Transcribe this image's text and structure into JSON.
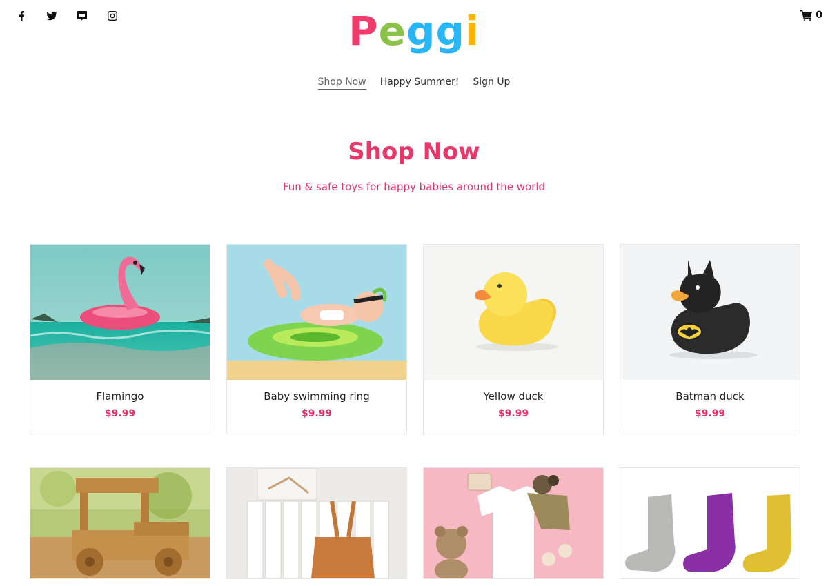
{
  "social": {
    "facebook_icon": "facebook-icon",
    "twitter_icon": "twitter-icon",
    "pinterest_icon": "message-icon",
    "instagram_icon": "instagram-icon"
  },
  "logo": {
    "letters": [
      "P",
      "e",
      "g",
      "g",
      "i"
    ],
    "colors": [
      "#f03b6b",
      "#8bc34a",
      "#29b6f6",
      "#29b6f6",
      "#ffb300"
    ]
  },
  "cart": {
    "icon": "cart-icon",
    "count": "0"
  },
  "nav": [
    {
      "label": "Shop Now",
      "active": true
    },
    {
      "label": "Happy Summer!",
      "active": false
    },
    {
      "label": "Sign Up",
      "active": false
    }
  ],
  "hero": {
    "title": "Shop Now",
    "subtitle": "Fun & safe toys for happy babies around the world"
  },
  "products": [
    {
      "name": "Flamingo",
      "price": "$9.99"
    },
    {
      "name": "Baby swimming ring",
      "price": "$9.99"
    },
    {
      "name": "Yellow duck",
      "price": "$9.99"
    },
    {
      "name": "Batman duck",
      "price": "$9.99"
    }
  ],
  "accent_color": "#e8386a"
}
